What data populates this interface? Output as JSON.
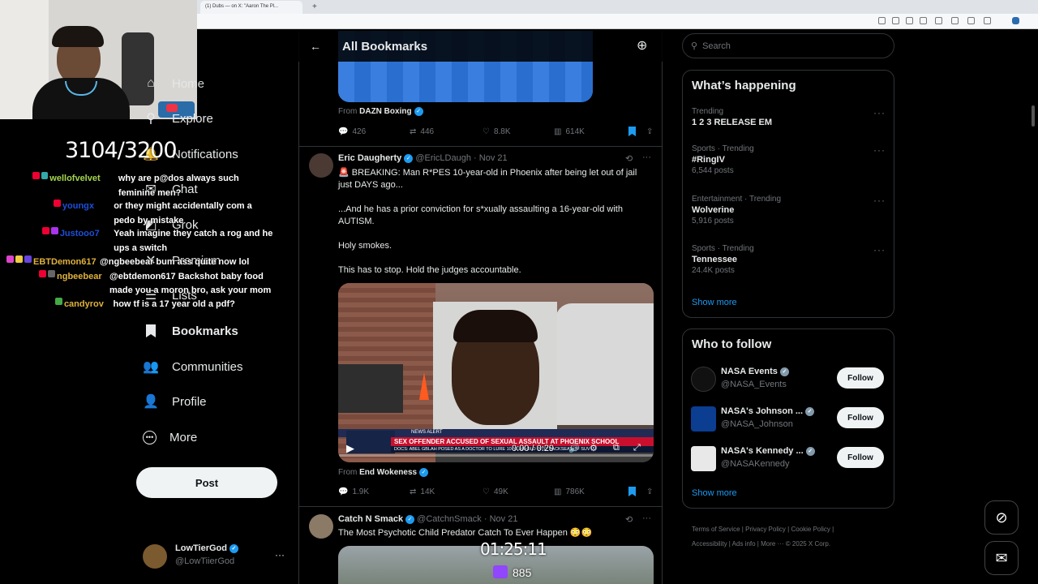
{
  "browser": {
    "tab_label": "(1) Dubs — on X: \"Aaron The Pl...",
    "new_tab": "+"
  },
  "stream": {
    "counter": "3104/3200",
    "timer": "01:25:11",
    "viewers": "885",
    "chat": [
      {
        "user": "wellofvelvet",
        "msg": "why are p@dos always such feminine men?",
        "user_color": "#a3d64e"
      },
      {
        "user": "youngx",
        "msg": "or they might accidentally com a pedo by mistake",
        "user_color": "#1d4ed8"
      },
      {
        "user": "Justooo7",
        "msg": "Yeah imagine they catch a rog and he ups a switch",
        "user_color": "#1d4ed8"
      },
      {
        "user": "EBTDemon617",
        "msg": "@ngbeebear bum ass quite now lol",
        "user_color": "#e0b23c"
      },
      {
        "user": "ngbeebear",
        "msg": "@ebtdemon617 Backshot baby food made you a moron bro, ask your mom",
        "user_color": "#e0b23c"
      },
      {
        "user": "candyrov",
        "msg": "how tf is a 17 year old a pdf?",
        "user_color": "#e0b23c"
      }
    ]
  },
  "nav": {
    "items": [
      {
        "label": "Home",
        "icon": "home-icon"
      },
      {
        "label": "Explore",
        "icon": "search-icon"
      },
      {
        "label": "Notifications",
        "icon": "bell-icon"
      },
      {
        "label": "Chat",
        "icon": "chat-icon"
      },
      {
        "label": "Grok",
        "icon": "grok-icon"
      },
      {
        "label": "Premium",
        "icon": "x-icon"
      },
      {
        "label": "Lists",
        "icon": "list-icon"
      },
      {
        "label": "Bookmarks",
        "icon": "bookmark-icon"
      },
      {
        "label": "Communities",
        "icon": "communities-icon"
      },
      {
        "label": "Profile",
        "icon": "profile-icon"
      },
      {
        "label": "More",
        "icon": "more-icon"
      }
    ],
    "post_label": "Post",
    "account": {
      "name": "LowTierGod",
      "handle": "@LowTiierGod"
    }
  },
  "header": {
    "title": "All Bookmarks"
  },
  "tweets": [
    {
      "from_label": "From",
      "from_name": "DAZN Boxing",
      "stats": {
        "replies": "426",
        "retweets": "446",
        "likes": "8.8K",
        "views": "614K"
      }
    },
    {
      "name": "Eric Daugherty",
      "handle": "@EricLDaugh",
      "time": "Nov 21",
      "lines": [
        "🚨 BREAKING: Man R*PES 10-year-old in Phoenix after being let out of jail just DAYS ago...",
        "...And he has a prior conviction for s*xually assaulting a 16-year-old with AUTISM.",
        "Holy smokes.",
        "This has to stop. Hold the judges accountable."
      ],
      "video": {
        "banner": "SEX OFFENDER ACCUSED OF SEXUAL ASSAULT AT PHOENIX SCHOOL",
        "sub": "DOCS: ABEL GBLAH POSED AS A DOCTOR TO LURE 10-YEAR-OLD INTO BACKSEAT OF SUV",
        "alert": "NEWS ALERT",
        "time": "0:00 / 0:29"
      },
      "from_label": "From",
      "from_name": "End Wokeness",
      "stats": {
        "replies": "1.9K",
        "retweets": "14K",
        "likes": "49K",
        "views": "786K"
      }
    },
    {
      "name": "Catch N Smack",
      "handle": "@CatchnSmack",
      "time": "Nov 21",
      "text": "The Most Psychotic Child Predator Catch To Ever Happen 😳😳"
    }
  ],
  "search": {
    "placeholder": "Search"
  },
  "trends": {
    "title": "What’s happening",
    "items": [
      {
        "meta": "Trending",
        "title": "1 2 3 RELEASE EM",
        "posts": ""
      },
      {
        "meta": "Sports · Trending",
        "title": "#RingIV",
        "posts": "6,544 posts"
      },
      {
        "meta": "Entertainment · Trending",
        "title": "Wolverine",
        "posts": "5,916 posts"
      },
      {
        "meta": "Sports · Trending",
        "title": "Tennessee",
        "posts": "24.4K posts"
      }
    ],
    "show_more": "Show more"
  },
  "who_to_follow": {
    "title": "Who to follow",
    "follow_label": "Follow",
    "accounts": [
      {
        "name": "NASA Events",
        "handle": "@NASA_Events"
      },
      {
        "name": "NASA's Johnson ...",
        "handle": "@NASA_Johnson"
      },
      {
        "name": "NASA's Kennedy ...",
        "handle": "@NASAKennedy"
      }
    ],
    "show_more": "Show more"
  },
  "footer": {
    "links": [
      "Terms of Service",
      "Privacy Policy",
      "Cookie Policy",
      "Accessibility",
      "Ads info",
      "More ···",
      "© 2025 X Corp."
    ]
  },
  "colors": {
    "accent": "#1d9bf0",
    "background": "#000000",
    "border": "#2f3336"
  }
}
